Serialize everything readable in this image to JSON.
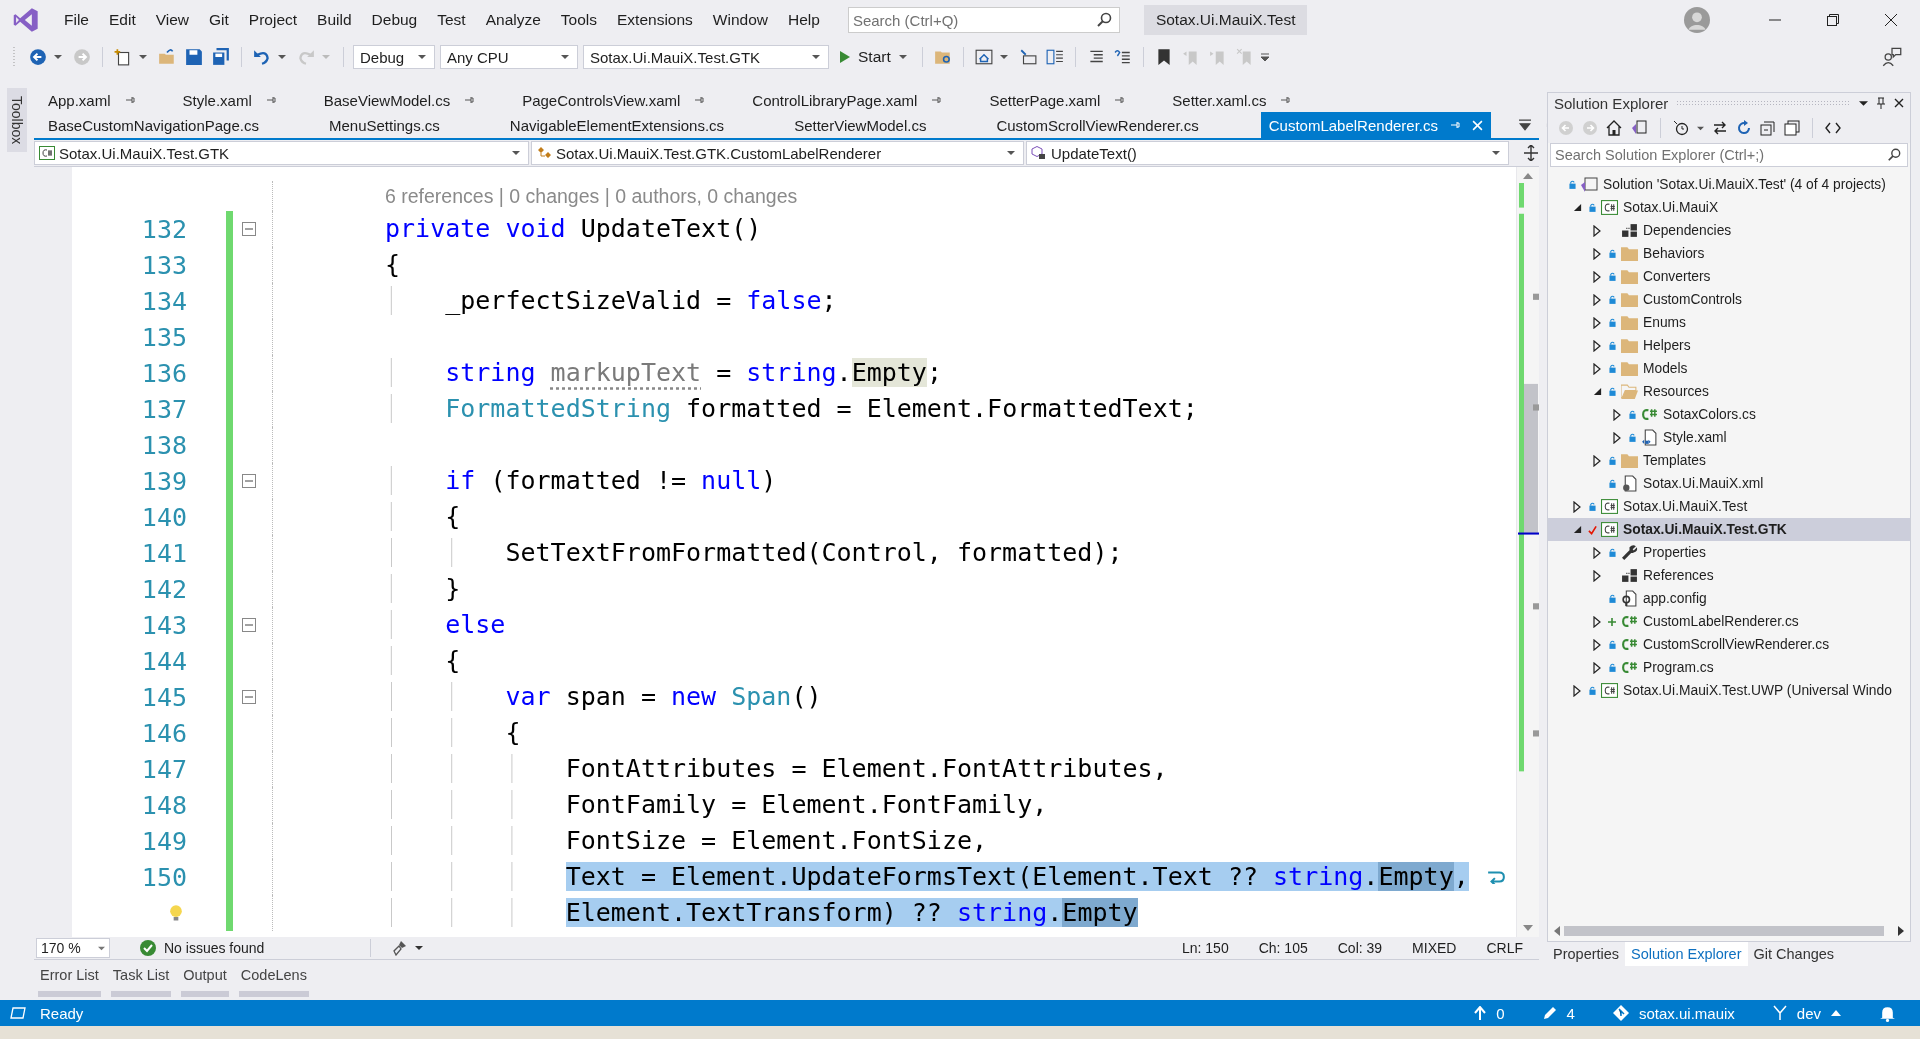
{
  "window": {
    "title": "Sotax.Ui.MauiX.Test",
    "search_placeholder": "Search (Ctrl+Q)"
  },
  "menu": [
    "File",
    "Edit",
    "View",
    "Git",
    "Project",
    "Build",
    "Debug",
    "Test",
    "Analyze",
    "Tools",
    "Extensions",
    "Window",
    "Help"
  ],
  "toolbar": {
    "configuration": "Debug",
    "platform": "Any CPU",
    "startup_project": "Sotax.Ui.MauiX.Test.GTK",
    "start": "Start"
  },
  "toolbox": "Toolbox",
  "tab_rows": [
    [
      {
        "label": "App.xaml",
        "pinned": true,
        "selected": false
      },
      {
        "label": "Style.xaml",
        "pinned": true,
        "selected": false
      },
      {
        "label": "BaseViewModel.cs",
        "pinned": true,
        "selected": false
      },
      {
        "label": "PageControlsView.xaml",
        "pinned": true,
        "selected": false
      },
      {
        "label": "ControlLibraryPage.xaml",
        "pinned": true,
        "selected": false
      },
      {
        "label": "SetterPage.xaml",
        "pinned": true,
        "selected": false
      },
      {
        "label": "Setter.xaml.cs",
        "pinned": true,
        "selected": false
      }
    ],
    [
      {
        "label": "BaseCustomNavigationPage.cs",
        "pinned": false,
        "selected": false
      },
      {
        "label": "MenuSettings.cs",
        "pinned": false,
        "selected": false
      },
      {
        "label": "NavigableElementExtensions.cs",
        "pinned": false,
        "selected": false
      },
      {
        "label": "SetterViewModel.cs",
        "pinned": false,
        "selected": false
      },
      {
        "label": "CustomScrollViewRenderer.cs",
        "pinned": false,
        "selected": false
      },
      {
        "label": "CustomLabelRenderer.cs",
        "pinned": true,
        "selected": true
      }
    ]
  ],
  "nav": {
    "project": "Sotax.Ui.MauiX.Test.GTK",
    "type": "Sotax.Ui.MauiX.Test.GTK.CustomLabelRenderer",
    "member": "UpdateText()"
  },
  "editor": {
    "codelens": "6 references | 0 changes | 0 authors, 0 changes",
    "lines": [
      {
        "number": "132",
        "changed": true,
        "fold": true,
        "selected": false,
        "lightbulb": false,
        "tokens": [
          {
            "text": "private void",
            "kind": "keyword"
          },
          {
            "text": " UpdateText()",
            "kind": "plain"
          }
        ]
      },
      {
        "number": "133",
        "changed": true,
        "fold": false,
        "selected": false,
        "lightbulb": false,
        "tokens": [
          {
            "text": "{",
            "kind": "plain"
          }
        ]
      },
      {
        "number": "134",
        "changed": true,
        "fold": false,
        "selected": false,
        "lightbulb": false,
        "tokens": [
          {
            "text": "    _perfectSizeValid = ",
            "kind": "plain"
          },
          {
            "text": "false",
            "kind": "keyword"
          },
          {
            "text": ";",
            "kind": "plain"
          }
        ]
      },
      {
        "number": "135",
        "changed": true,
        "fold": false,
        "selected": false,
        "lightbulb": false
      },
      {
        "number": "136",
        "changed": true,
        "fold": false,
        "selected": false,
        "lightbulb": false,
        "tokens": [
          {
            "text": "    string ",
            "kind": "keyword"
          },
          {
            "text": "markupText",
            "kind": "unused"
          },
          {
            "text": " = ",
            "kind": "plain"
          },
          {
            "text": "string",
            "kind": "keyword"
          },
          {
            "text": ".",
            "kind": "plain"
          },
          {
            "text": "Empty",
            "kind": "reference"
          },
          {
            "text": ";",
            "kind": "plain"
          }
        ]
      },
      {
        "number": "137",
        "changed": true,
        "fold": false,
        "selected": false,
        "lightbulb": false,
        "tokens": [
          {
            "text": "    FormattedString",
            "kind": "type"
          },
          {
            "text": " formatted = Element.FormattedText;",
            "kind": "plain"
          }
        ]
      },
      {
        "number": "138",
        "changed": true,
        "fold": false,
        "selected": false,
        "lightbulb": false
      },
      {
        "number": "139",
        "changed": true,
        "fold": true,
        "selected": false,
        "lightbulb": false,
        "tokens": [
          {
            "text": "    if",
            "kind": "keyword"
          },
          {
            "text": " (formatted != ",
            "kind": "plain"
          },
          {
            "text": "null",
            "kind": "keyword"
          },
          {
            "text": ")",
            "kind": "plain"
          }
        ]
      },
      {
        "number": "140",
        "changed": true,
        "fold": false,
        "selected": false,
        "lightbulb": false,
        "tokens": [
          {
            "text": "    {",
            "kind": "plain"
          }
        ]
      },
      {
        "number": "141",
        "changed": true,
        "fold": false,
        "selected": false,
        "lightbulb": false,
        "tokens": [
          {
            "text": "        SetTextFromFormatted(Control, formatted);",
            "kind": "plain"
          }
        ]
      },
      {
        "number": "142",
        "changed": true,
        "fold": false,
        "selected": false,
        "lightbulb": false,
        "tokens": [
          {
            "text": "    }",
            "kind": "plain"
          }
        ]
      },
      {
        "number": "143",
        "changed": true,
        "fold": true,
        "selected": false,
        "lightbulb": false,
        "tokens": [
          {
            "text": "    else",
            "kind": "keyword"
          }
        ]
      },
      {
        "number": "144",
        "changed": true,
        "fold": false,
        "selected": false,
        "lightbulb": false,
        "tokens": [
          {
            "text": "    {",
            "kind": "plain"
          }
        ]
      },
      {
        "number": "145",
        "changed": true,
        "fold": true,
        "selected": false,
        "lightbulb": false,
        "tokens": [
          {
            "text": "        var",
            "kind": "keyword"
          },
          {
            "text": " span = ",
            "kind": "plain"
          },
          {
            "text": "new ",
            "kind": "keyword"
          },
          {
            "text": "Span",
            "kind": "type"
          },
          {
            "text": "()",
            "kind": "plain"
          }
        ]
      },
      {
        "number": "146",
        "changed": true,
        "fold": false,
        "selected": false,
        "lightbulb": false,
        "tokens": [
          {
            "text": "        {",
            "kind": "plain"
          }
        ]
      },
      {
        "number": "147",
        "changed": true,
        "fold": false,
        "selected": false,
        "lightbulb": false,
        "tokens": [
          {
            "text": "            FontAttributes = Element.FontAttributes,",
            "kind": "plain"
          }
        ]
      },
      {
        "number": "148",
        "changed": true,
        "fold": false,
        "selected": false,
        "lightbulb": false,
        "tokens": [
          {
            "text": "            FontFamily = Element.FontFamily,",
            "kind": "plain"
          }
        ]
      },
      {
        "number": "149",
        "changed": true,
        "fold": false,
        "selected": false,
        "lightbulb": false,
        "tokens": [
          {
            "text": "            FontSize = Element.FontSize,",
            "kind": "plain"
          }
        ]
      },
      {
        "number": "150",
        "changed": true,
        "fold": false,
        "selected": true,
        "lightbulb": true,
        "tokens": [
          {
            "text": "            Text = Element.UpdateFormsText(Element.Text ?? ",
            "kind": "plain"
          },
          {
            "text": "string",
            "kind": "keyword"
          },
          {
            "text": ".",
            "kind": "plain"
          },
          {
            "text": "Empty",
            "kind": "reference"
          },
          {
            "text": ",",
            "kind": "plain"
          }
        ],
        "wrap": [
          {
            "text": "Element.TextTransform) ?? ",
            "kind": "plain"
          },
          {
            "text": "string",
            "kind": "keyword"
          },
          {
            "text": ".",
            "kind": "plain"
          },
          {
            "text": "Empty",
            "kind": "reference"
          }
        ]
      }
    ]
  },
  "editor_status": {
    "zoom": "170 %",
    "issues": "No issues found",
    "line": "Ln: 150",
    "char": "Ch: 105",
    "col": "Col: 39",
    "whitespace": "MIXED",
    "eol": "CRLF"
  },
  "tool_tabs": [
    "Error List",
    "Task List",
    "Output",
    "CodeLens"
  ],
  "solution_explorer": {
    "title": "Solution Explorer",
    "search_placeholder": "Search Solution Explorer (Ctrl+;)",
    "tree": [
      {
        "label": "Solution 'Sotax.Ui.MauiX.Test' (4 of 4 projects)",
        "kind": "solution",
        "locked": true,
        "checked_out": false,
        "added": false,
        "selected": false,
        "startup": false,
        "children": [
          {
            "label": "Sotax.Ui.MauiX",
            "kind": "project",
            "locked": true,
            "checked_out": false,
            "added": false,
            "expanded": true,
            "selected": false,
            "startup": false,
            "children": [
              {
                "label": "Dependencies",
                "kind": "dependencies",
                "locked": false,
                "checked_out": false,
                "added": false,
                "expanded": false,
                "selected": false,
                "startup": false
              },
              {
                "label": "Behaviors",
                "kind": "folder",
                "locked": true,
                "checked_out": false,
                "added": false,
                "expanded": false,
                "selected": false,
                "startup": false
              },
              {
                "label": "Converters",
                "kind": "folder",
                "locked": true,
                "checked_out": false,
                "added": false,
                "expanded": false,
                "selected": false,
                "startup": false
              },
              {
                "label": "CustomControls",
                "kind": "folder",
                "locked": true,
                "checked_out": false,
                "added": false,
                "expanded": false,
                "selected": false,
                "startup": false
              },
              {
                "label": "Enums",
                "kind": "folder",
                "locked": true,
                "checked_out": false,
                "added": false,
                "expanded": false,
                "selected": false,
                "startup": false
              },
              {
                "label": "Helpers",
                "kind": "folder",
                "locked": true,
                "checked_out": false,
                "added": false,
                "expanded": false,
                "selected": false,
                "startup": false
              },
              {
                "label": "Models",
                "kind": "folder",
                "locked": true,
                "checked_out": false,
                "added": false,
                "expanded": false,
                "selected": false,
                "startup": false
              },
              {
                "label": "Resources",
                "kind": "folder",
                "locked": true,
                "checked_out": false,
                "added": false,
                "expanded": true,
                "selected": false,
                "startup": false,
                "children": [
                  {
                    "label": "SotaxColors.cs",
                    "kind": "csharp",
                    "locked": true,
                    "checked_out": false,
                    "added": false,
                    "expanded": false,
                    "selected": false,
                    "startup": false
                  },
                  {
                    "label": "Style.xaml",
                    "kind": "xaml",
                    "locked": true,
                    "checked_out": false,
                    "added": false,
                    "expanded": false,
                    "selected": false,
                    "startup": false
                  }
                ]
              },
              {
                "label": "Templates",
                "kind": "folder",
                "locked": true,
                "checked_out": false,
                "added": false,
                "expanded": false,
                "selected": false,
                "startup": false
              },
              {
                "label": "Sotax.Ui.MauiX.xml",
                "kind": "xml",
                "locked": true,
                "checked_out": false,
                "added": false,
                "selected": false,
                "startup": false
              }
            ]
          },
          {
            "label": "Sotax.Ui.MauiX.Test",
            "kind": "project",
            "locked": true,
            "checked_out": false,
            "added": false,
            "expanded": false,
            "selected": false,
            "startup": false
          },
          {
            "label": "Sotax.Ui.MauiX.Test.GTK",
            "kind": "project",
            "locked": false,
            "checked_out": true,
            "added": false,
            "expanded": true,
            "selected": true,
            "startup": true,
            "children": [
              {
                "label": "Properties",
                "kind": "properties",
                "locked": true,
                "checked_out": false,
                "added": false,
                "expanded": false,
                "selected": false,
                "startup": false
              },
              {
                "label": "References",
                "kind": "dependencies",
                "locked": false,
                "checked_out": false,
                "added": false,
                "expanded": false,
                "selected": false,
                "startup": false
              },
              {
                "label": "app.config",
                "kind": "config",
                "locked": true,
                "checked_out": false,
                "added": false,
                "selected": false,
                "startup": false
              },
              {
                "label": "CustomLabelRenderer.cs",
                "kind": "csharp",
                "locked": false,
                "checked_out": false,
                "added": true,
                "expanded": false,
                "selected": false,
                "startup": false
              },
              {
                "label": "CustomScrollViewRenderer.cs",
                "kind": "csharp",
                "locked": true,
                "checked_out": false,
                "added": false,
                "expanded": false,
                "selected": false,
                "startup": false
              },
              {
                "label": "Program.cs",
                "kind": "csharp",
                "locked": true,
                "checked_out": false,
                "added": false,
                "expanded": false,
                "selected": false,
                "startup": false
              }
            ]
          },
          {
            "label": "Sotax.Ui.MauiX.Test.UWP (Universal Windo",
            "kind": "project",
            "locked": true,
            "checked_out": false,
            "added": false,
            "expanded": false,
            "selected": false,
            "startup": false
          }
        ]
      }
    ],
    "bottom_tabs": [
      {
        "label": "Properties",
        "selected": false
      },
      {
        "label": "Solution Explorer",
        "selected": true
      },
      {
        "label": "Git Changes",
        "selected": false
      }
    ]
  },
  "status_bar": {
    "state": "Ready",
    "unpushed": "0",
    "changes": "4",
    "repository": "sotax.ui.mauix",
    "branch": "dev"
  }
}
